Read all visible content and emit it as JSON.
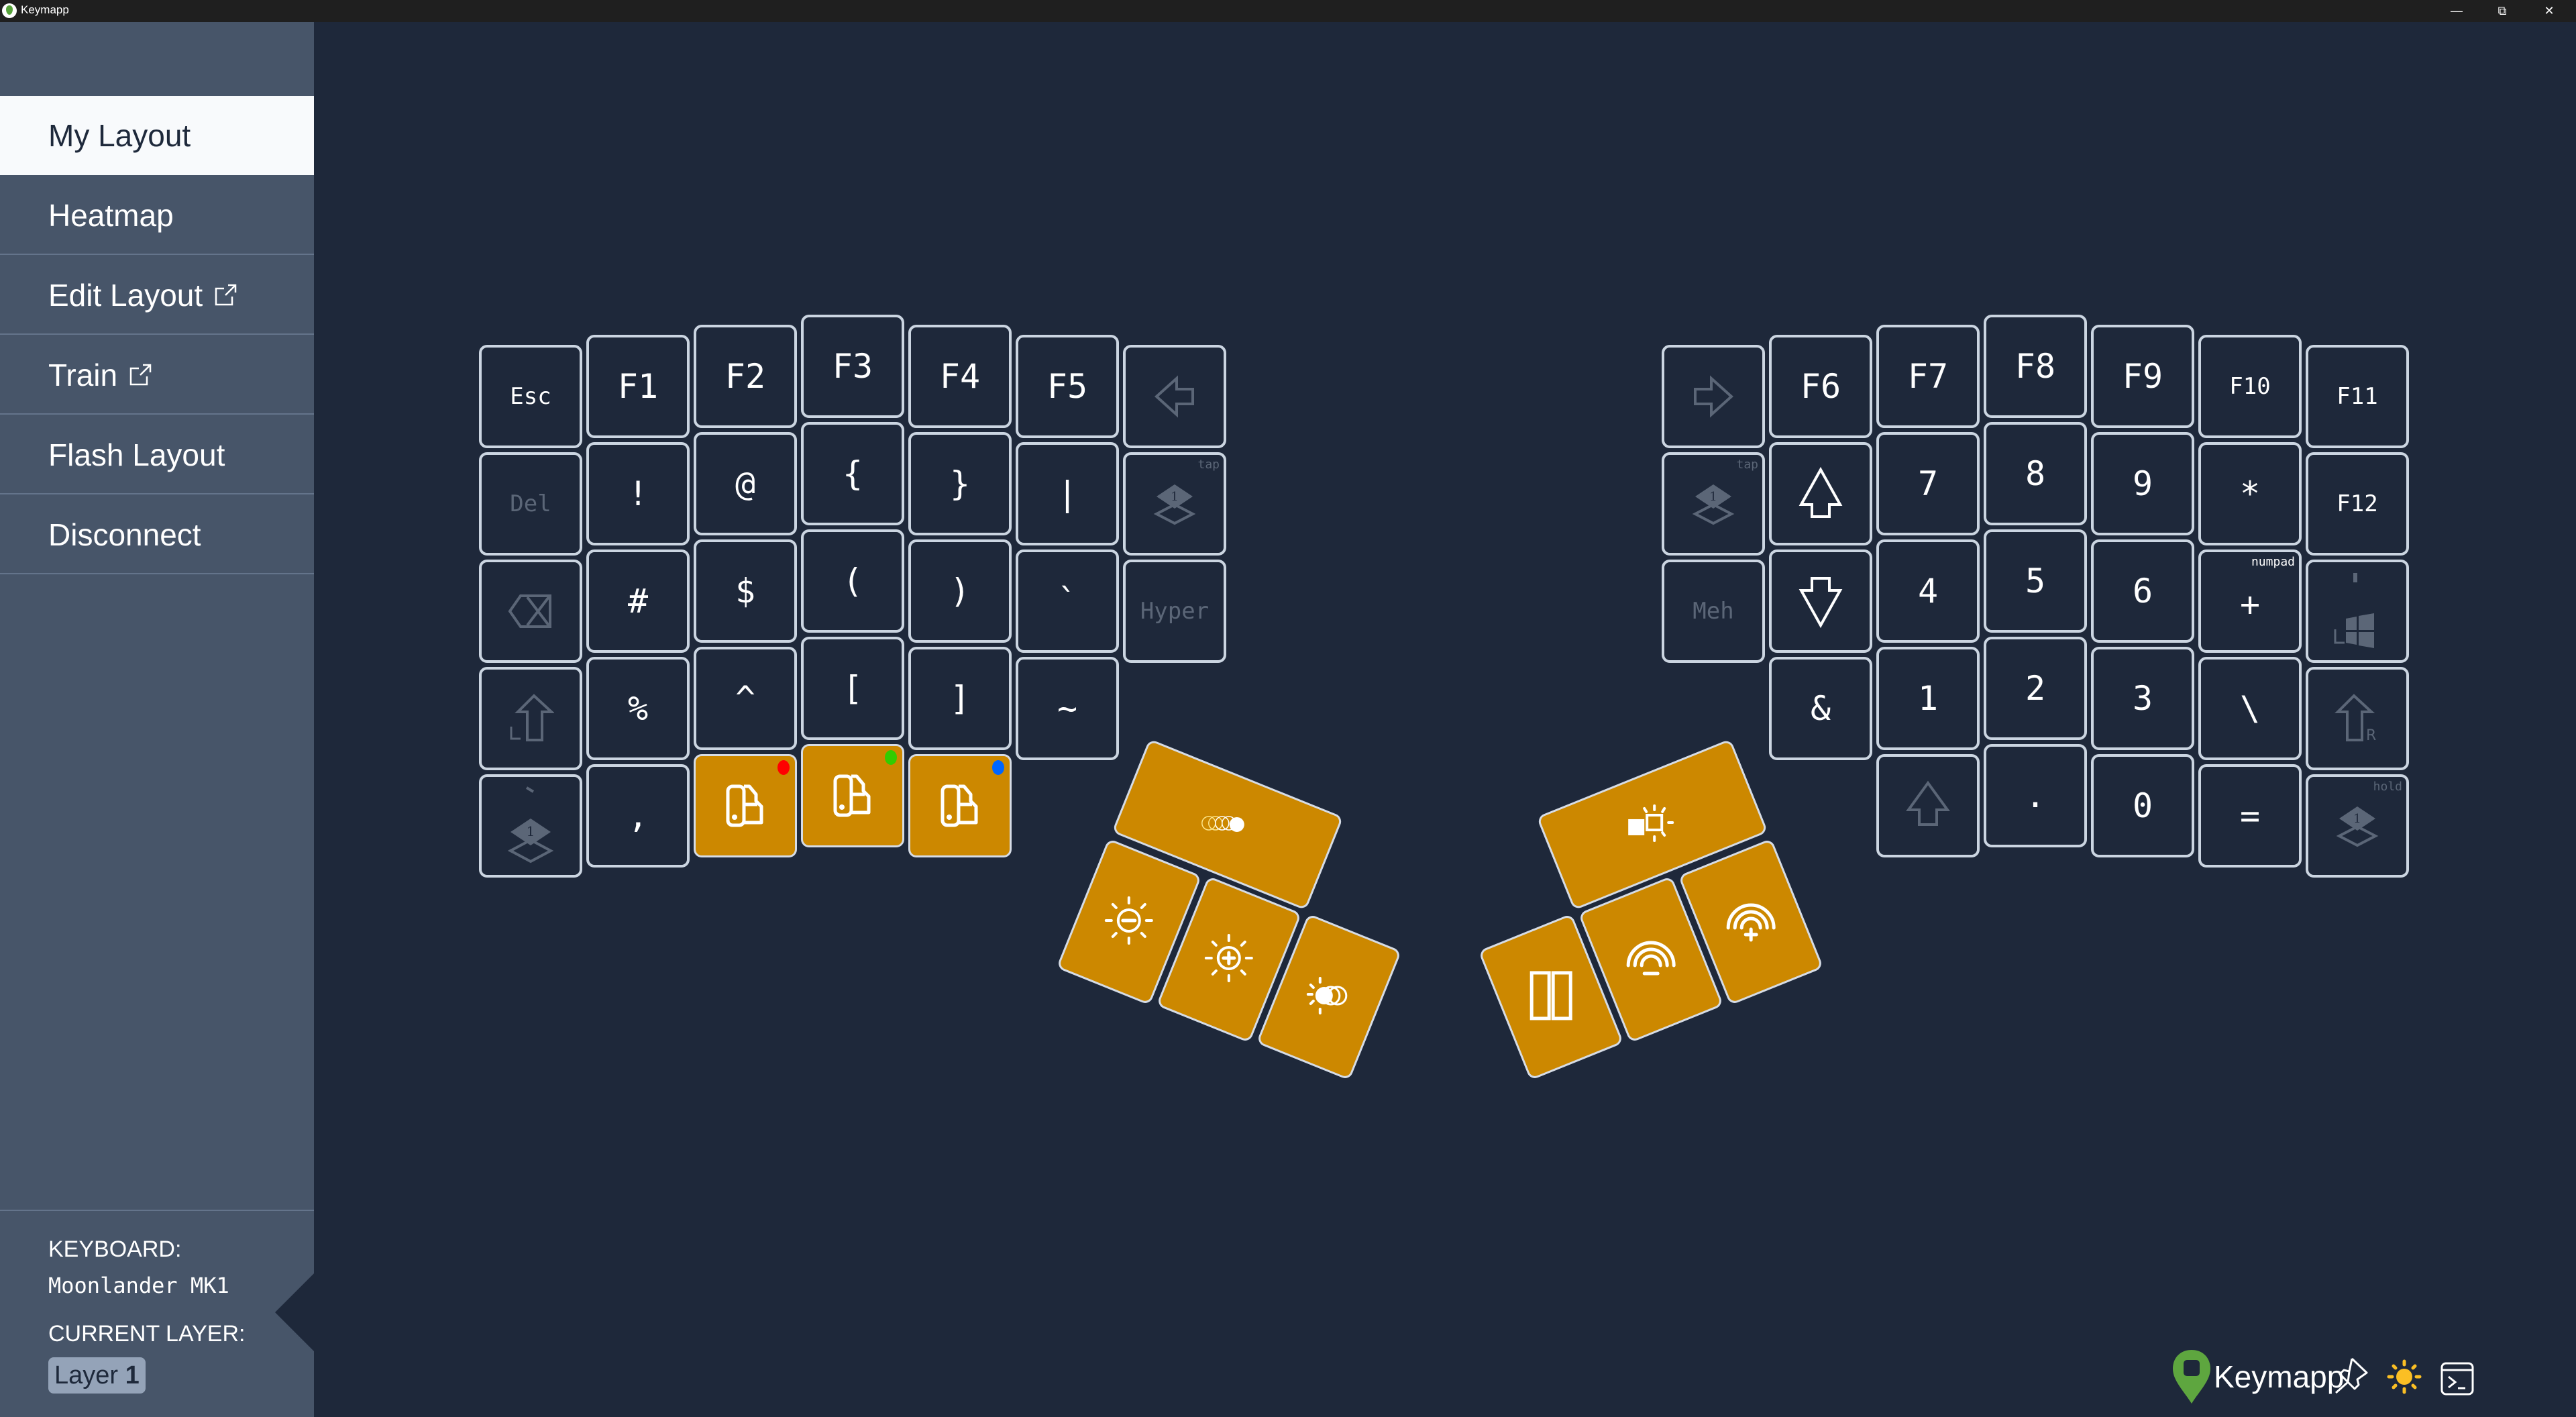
{
  "window": {
    "title": "Keymapp",
    "controls": [
      "minimize",
      "restore",
      "close"
    ]
  },
  "sidebar": {
    "items": [
      {
        "label": "My Layout",
        "active": true,
        "external": false
      },
      {
        "label": "Heatmap",
        "active": false,
        "external": false
      },
      {
        "label": "Edit Layout",
        "active": false,
        "external": true
      },
      {
        "label": "Train",
        "active": false,
        "external": true
      },
      {
        "label": "Flash Layout",
        "active": false,
        "external": false
      },
      {
        "label": "Disconnect",
        "active": false,
        "external": false
      }
    ],
    "keyboard_label": "KEYBOARD:",
    "keyboard_value": "Moonlander MK1",
    "layer_label": "CURRENT LAYER:",
    "layer_prefix": "Layer",
    "layer_number": "1"
  },
  "keyboard": {
    "accent_color": "#cc8800",
    "left": [
      [
        {
          "label": "Esc",
          "style": "small"
        },
        {
          "label": "F1"
        },
        {
          "label": "F2"
        },
        {
          "label": "F3"
        },
        {
          "label": "F4"
        },
        {
          "label": "F5"
        },
        {
          "icon": "arrow-left-icon",
          "dim": true
        }
      ],
      [
        {
          "label": "Del",
          "dim": true,
          "style": "small"
        },
        {
          "label": "!"
        },
        {
          "label": "@"
        },
        {
          "label": "{"
        },
        {
          "label": "}"
        },
        {
          "label": "|"
        },
        {
          "icon": "layer-icon",
          "dim": true,
          "sub": "tap"
        }
      ],
      [
        {
          "icon": "backspace-icon",
          "dim": true
        },
        {
          "label": "#"
        },
        {
          "label": "$"
        },
        {
          "label": "("
        },
        {
          "label": ")"
        },
        {
          "label": "`"
        },
        {
          "label": "Hyper",
          "dim": true,
          "style": "small"
        }
      ],
      [
        {
          "icon": "shift-left-icon",
          "dim": true
        },
        {
          "label": "%"
        },
        {
          "label": "^"
        },
        {
          "label": "["
        },
        {
          "label": "]"
        },
        {
          "label": "~"
        },
        null
      ],
      [
        {
          "icon": "layer-grave-icon",
          "dim": true
        },
        {
          "label": ","
        },
        {
          "icon": "bluetooth-profile-icon",
          "orange": true,
          "dot": "#ff0000"
        },
        {
          "icon": "bluetooth-profile-icon",
          "orange": true,
          "dot": "#33cc00"
        },
        {
          "icon": "bluetooth-profile-icon",
          "orange": true,
          "dot": "#0066ff"
        },
        null,
        null
      ]
    ],
    "right": [
      [
        {
          "icon": "arrow-right-icon",
          "dim": true
        },
        {
          "label": "F6"
        },
        {
          "label": "F7"
        },
        {
          "label": "F8"
        },
        {
          "label": "F9"
        },
        {
          "label": "F10",
          "style": "small"
        },
        {
          "label": "F11",
          "style": "small"
        }
      ],
      [
        {
          "icon": "layer-icon",
          "dim": true,
          "sub": "tap"
        },
        {
          "icon": "arrow-up-icon"
        },
        {
          "label": "7"
        },
        {
          "label": "8"
        },
        {
          "label": "9"
        },
        {
          "label": "*"
        },
        {
          "label": "F12",
          "style": "small"
        }
      ],
      [
        {
          "label": "Meh",
          "dim": true,
          "style": "small"
        },
        {
          "icon": "arrow-down-icon"
        },
        {
          "label": "4"
        },
        {
          "label": "5"
        },
        {
          "label": "6"
        },
        {
          "label": "+",
          "sub": "numpad",
          "sub_bright": true
        },
        {
          "icon": "windows-icon",
          "dim": true,
          "top": "'"
        }
      ],
      [
        null,
        {
          "label": "&"
        },
        {
          "label": "1"
        },
        {
          "label": "2"
        },
        {
          "label": "3"
        },
        {
          "label": "\\"
        },
        {
          "icon": "shift-right-icon",
          "dim": true
        }
      ],
      [
        null,
        null,
        {
          "icon": "caps-word-icon",
          "dim": true
        },
        {
          "label": "."
        },
        {
          "label": "0"
        },
        {
          "label": "="
        },
        {
          "icon": "layer-icon",
          "dim": true,
          "sub": "hold"
        }
      ]
    ],
    "left_thumb": [
      {
        "icon": "rgb-animation-icon"
      },
      {
        "icon": "brightness-down-icon"
      },
      {
        "icon": "brightness-up-icon"
      },
      {
        "icon": "brightness-cycle-icon"
      }
    ],
    "right_thumb": [
      {
        "icon": "rgb-toggle-icon"
      },
      {
        "icon": "layout-switch-icon"
      },
      {
        "icon": "rgb-hue-down-icon"
      },
      {
        "icon": "rgb-hue-up-icon"
      }
    ]
  },
  "bottombar": {
    "brand": "Keymapp",
    "brand_color": "#5ea63f",
    "icons": [
      "pin-icon",
      "theme-sun-icon",
      "terminal-icon"
    ],
    "sun_color": "#fbbf24"
  }
}
